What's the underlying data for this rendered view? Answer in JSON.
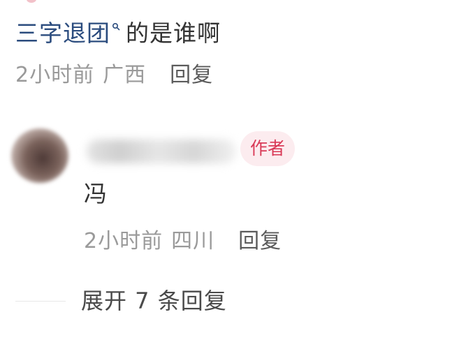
{
  "comment": {
    "mention": "三字退团",
    "search_icon": "search-icon",
    "text": "的是谁啊",
    "time": "2小时前",
    "location": "广西",
    "reply_label": "回复"
  },
  "reply": {
    "author_badge": "作者",
    "text": "冯",
    "time": "2小时前",
    "location": "四川",
    "reply_label": "回复"
  },
  "expand": {
    "label": "展开 7 条回复"
  },
  "colors": {
    "mention": "#2b4c7e",
    "badge_text": "#d93a57",
    "badge_bg": "#fcecef",
    "meta_text": "#9a9a9a",
    "reply_label": "#5b5b5b"
  }
}
